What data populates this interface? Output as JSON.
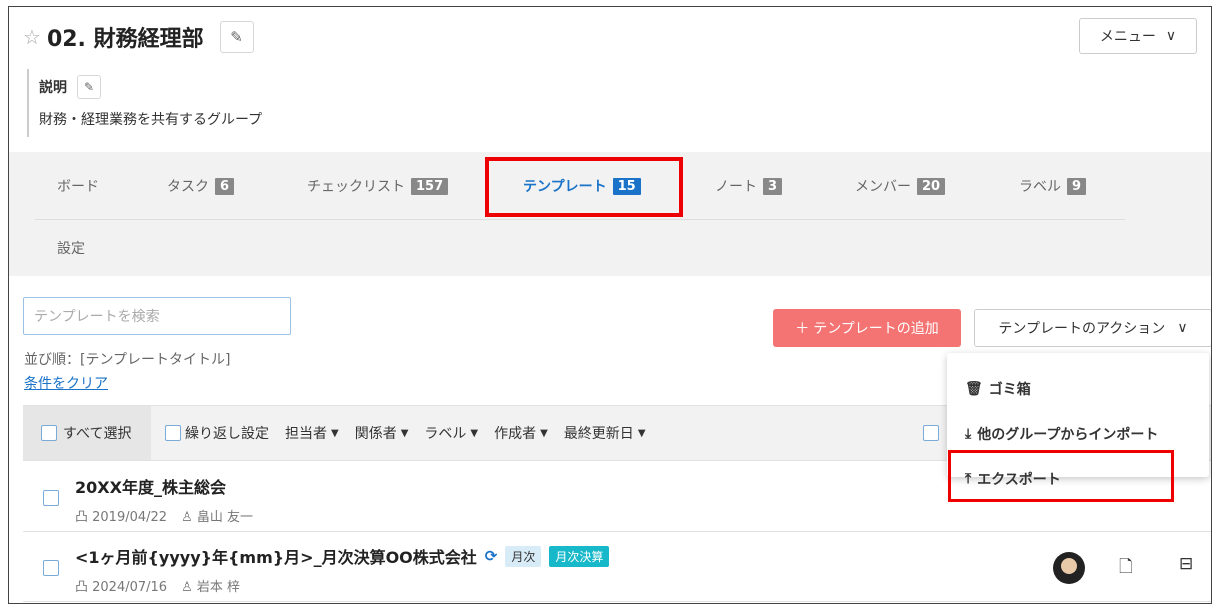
{
  "header": {
    "title": "02. 財務経理部",
    "menu_label": "メニュー"
  },
  "description": {
    "label": "説明",
    "text": "財務・経理業務を共有するグループ"
  },
  "tabs": [
    {
      "label": "ボード",
      "count": ""
    },
    {
      "label": "タスク",
      "count": "6"
    },
    {
      "label": "チェックリスト",
      "count": "157"
    },
    {
      "label": "テンプレート",
      "count": "15"
    },
    {
      "label": "ノート",
      "count": "3"
    },
    {
      "label": "メンバー",
      "count": "20"
    },
    {
      "label": "ラベル",
      "count": "9"
    }
  ],
  "settings_tab": "設定",
  "search": {
    "placeholder": "テンプレートを検索"
  },
  "sort_text": "並び順：[テンプレートタイトル]",
  "clear_label": "条件をクリア",
  "add_button": "テンプレートの追加",
  "action_button": "テンプレートのアクション",
  "filters": {
    "select_all": "すべて選択",
    "repeat": "繰り返し設定",
    "assignee": "担当者",
    "related": "関係者",
    "label": "ラベル",
    "creator": "作成者",
    "updated": "最終更新日"
  },
  "rows": [
    {
      "title": "20XX年度_株主総会",
      "date": "2019/04/22",
      "user": "畠山 友一",
      "tags": []
    },
    {
      "title": "<1ヶ月前{yyyy}年{mm}月>_月次決算OO株式会社",
      "date": "2024/07/16",
      "user": "岩本 梓",
      "tags": [
        "月次",
        "月次決算"
      ]
    }
  ],
  "dropdown": [
    {
      "label": "ゴミ箱",
      "icon": "trash-icon"
    },
    {
      "label": "他のグループからインポート",
      "icon": "import-icon"
    },
    {
      "label": "エクスポート",
      "icon": "export-icon"
    }
  ],
  "colors": {
    "accent": "#1a73c8",
    "add_button": "#f47373",
    "highlight": "#e00000",
    "tag_teal": "#17b8c9"
  }
}
